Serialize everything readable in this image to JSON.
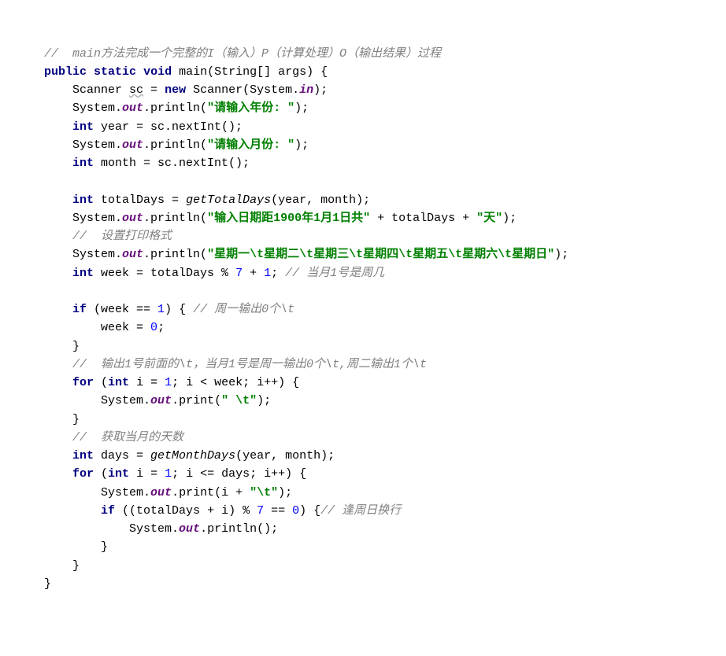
{
  "code": {
    "c1": "//  main方法完成一个完整的I（输入）P（计算处理）O（输出结果）过程",
    "kw_public": "public",
    "kw_static": "static",
    "kw_void": "void",
    "main": "main",
    "args_decl": "(String[] args) {",
    "scanner": "Scanner ",
    "sc_var": "sc",
    "eq": " = ",
    "kw_new": "new",
    "scanner_call": " Scanner(System.",
    "in_field": "in",
    "close_paren_semi": ");",
    "sys": "System.",
    "out_field": "out",
    "println_open": ".println(",
    "print_open": ".print(",
    "str_year": "\"请输入年份: \"",
    "kw_int": "int",
    "year_decl": " year = sc.nextInt();",
    "str_month": "\"请输入月份: \"",
    "month_decl": " month = sc.nextInt();",
    "total_decl_a": " totalDays = ",
    "getTotalDays": "getTotalDays",
    "total_args": "(year, month);",
    "str_a": "\"输入日期距1900年1月1日共\"",
    "plus_total": " + totalDays + ",
    "str_day": "\"天\"",
    "c2": "//  设置打印格式",
    "str_week": "\"星期一\\t星期二\\t星期三\\t星期四\\t星期五\\t星期六\\t星期日\"",
    "week_decl_a": " week = totalDays % ",
    "seven": "7",
    "plus": " + ",
    "one": "1",
    "semi": "; ",
    "c3": "// 当月1号是周几",
    "kw_if": "if",
    "if_cond_a": " (week == ",
    "brace_open": ") { ",
    "c4": "// 周一输出0个\\t",
    "week_zero_a": "week = ",
    "zero": "0",
    "just_semi": ";",
    "brace_close": "}",
    "c5": "//  输出1号前面的\\t，当月1号是周一输出0个\\t,周二输出1个\\t",
    "kw_for": "for",
    "for1_a": " (",
    "for1_b": " i = ",
    "for1_c": "; i < week; i++) {",
    "str_tab1": "\" \\t\"",
    "c6": "//  获取当月的天数",
    "days_decl_a": " days = ",
    "getMonthDays": "getMonthDays",
    "for2_c": "; i <= days; i++) {",
    "print_arg2": "i + ",
    "str_tab2": "\"\\t\"",
    "if2_a": " ((totalDays + i) % ",
    "if2_b": " == ",
    "if2_c": ") {",
    "c7": "// 逢周日换行",
    "println_empty": "();"
  }
}
